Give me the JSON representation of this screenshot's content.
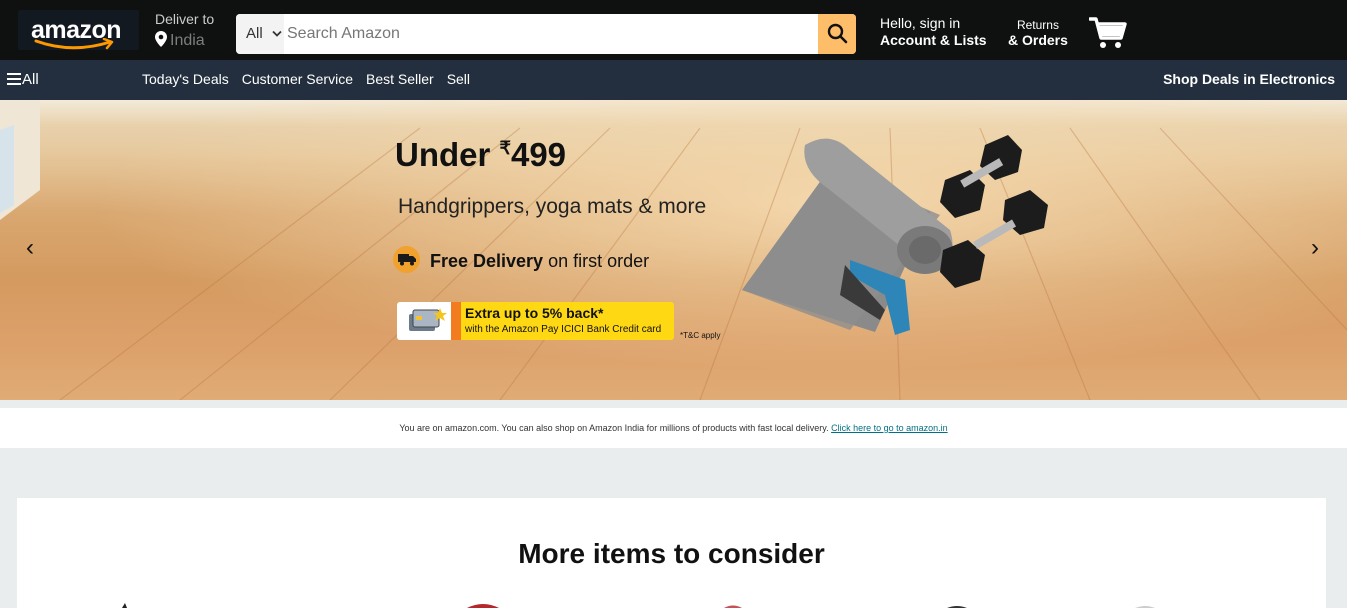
{
  "header": {
    "logo_text": "amazon",
    "deliver_label": "Deliver to",
    "deliver_location": "India",
    "search": {
      "category": "All",
      "placeholder": "Search Amazon"
    },
    "account_line1": "Hello, sign in",
    "account_line2": "Account & Lists",
    "returns_line1": "Returns",
    "returns_line2": "& Orders"
  },
  "subnav": {
    "all_label": "All",
    "links": [
      "Today's Deals",
      "Customer Service",
      "Best Seller",
      "Sell"
    ],
    "promo_link": "Shop Deals in Electronics"
  },
  "hero": {
    "title_prefix": "Under ",
    "currency": "₹",
    "price": "499",
    "subtitle": "Handgrippers, yoga mats & more",
    "delivery_bold": "Free Delivery",
    "delivery_rest": " on first order",
    "promo_line1": "Extra up to 5% back*",
    "promo_line2": "with the Amazon Pay ICICI Bank Credit card",
    "tnc": "*T&C apply",
    "prev_arrow": "‹",
    "next_arrow": "›"
  },
  "notice": {
    "text": "You are on amazon.com. You can also shop on Amazon India for millions of products with fast local delivery. ",
    "link": "Click here to go to amazon.in"
  },
  "more": {
    "title": "More items to consider"
  },
  "colors": {
    "topnav": "#0f1111",
    "subnav": "#232f3e",
    "search_button": "#febd69",
    "link": "#007185"
  }
}
